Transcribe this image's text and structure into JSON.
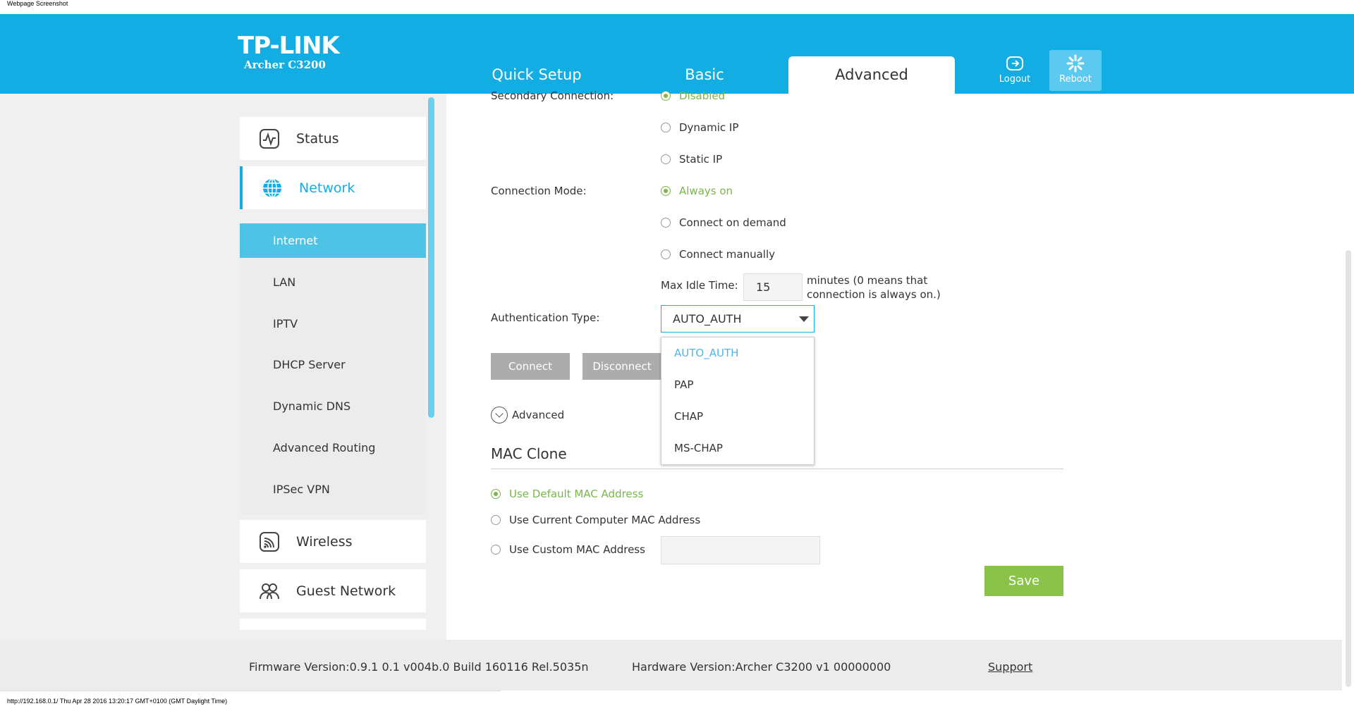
{
  "page_label": "Webpage Screenshot",
  "header": {
    "logo": "TP-LINK",
    "model": "Archer C3200",
    "tabs": [
      {
        "label": "Quick Setup"
      },
      {
        "label": "Basic"
      },
      {
        "label": "Advanced",
        "active": true
      }
    ],
    "logout_label": "Logout",
    "reboot_label": "Reboot"
  },
  "sidebar": {
    "status": "Status",
    "network": "Network",
    "sub_items": [
      {
        "label": "Internet",
        "active": true
      },
      {
        "label": "LAN"
      },
      {
        "label": "IPTV"
      },
      {
        "label": "DHCP Server"
      },
      {
        "label": "Dynamic DNS"
      },
      {
        "label": "Advanced Routing"
      },
      {
        "label": "IPSec VPN"
      }
    ],
    "wireless": "Wireless",
    "guest_network": "Guest Network"
  },
  "form": {
    "secondary_connection_label": "Secondary Connection:",
    "secondary_options": [
      "Disabled",
      "Dynamic IP",
      "Static IP"
    ],
    "secondary_selected": "Disabled",
    "connection_mode_label": "Connection Mode:",
    "connection_mode_options": [
      "Always on",
      "Connect on demand",
      "Connect manually"
    ],
    "connection_mode_selected": "Always on",
    "max_idle_label": "Max Idle Time:",
    "max_idle_value": "15",
    "max_idle_hint_1": "minutes (0 means that",
    "max_idle_hint_2": "connection is always on.)",
    "auth_type_label": "Authentication Type:",
    "auth_type_value": "AUTO_AUTH",
    "auth_options": [
      "AUTO_AUTH",
      "PAP",
      "CHAP",
      "MS-CHAP"
    ],
    "connect_label": "Connect",
    "disconnect_label": "Disconnect",
    "advanced_label": "Advanced",
    "mac_clone_title": "MAC Clone",
    "mac_options": [
      "Use Default MAC Address",
      "Use Current Computer MAC Address",
      "Use Custom MAC Address"
    ],
    "mac_selected": "Use Default MAC Address",
    "custom_mac_value": "",
    "save_label": "Save"
  },
  "footer": {
    "firmware": "Firmware Version:0.9.1 0.1 v004b.0 Build 160116 Rel.5035n",
    "hardware": "Hardware Version:Archer C3200 v1 00000000",
    "support": "Support"
  },
  "status_bar": "http://192.168.0.1/ Thu Apr 28 2016 13:20:17 GMT+0100 (GMT Daylight Time)",
  "colors": {
    "brand": "#12ade3",
    "accent_green": "#7ab648",
    "save_green": "#8bc34a",
    "active_sub": "#4fc3e6"
  }
}
